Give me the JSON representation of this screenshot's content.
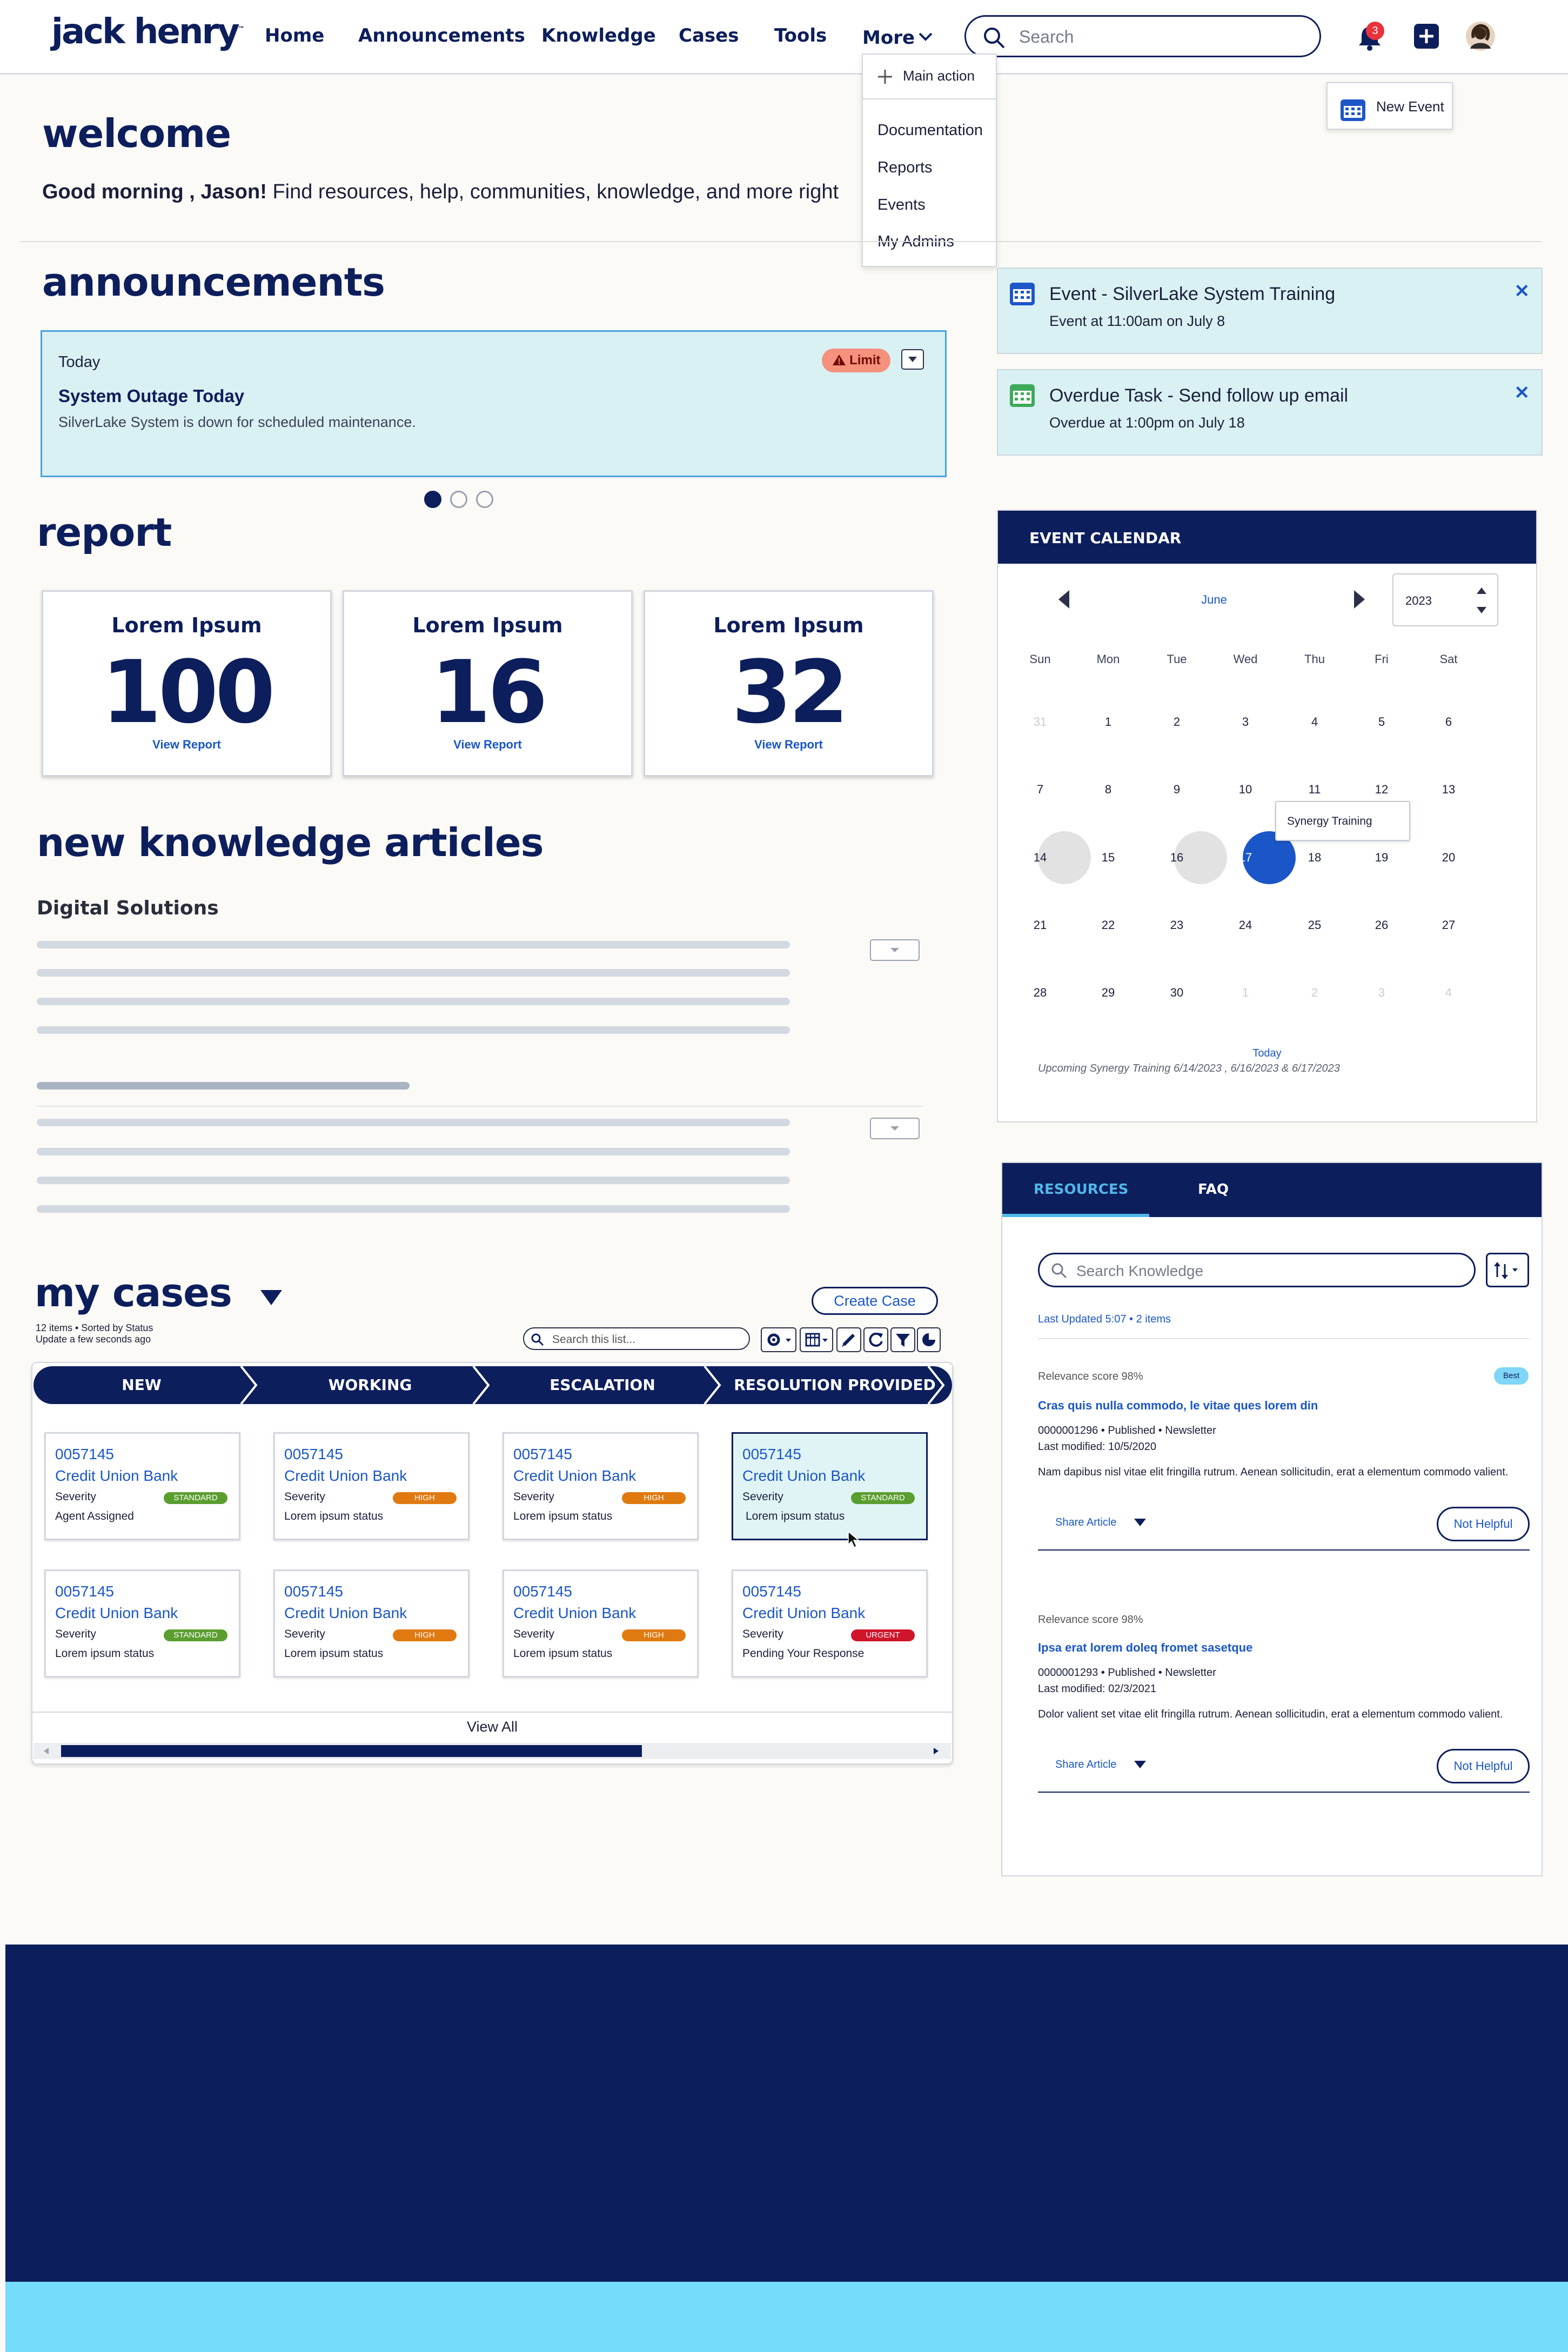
{
  "header": {
    "logo": "jack henry",
    "logo_tm": "™",
    "nav": [
      "Home",
      "Announcements",
      "Knowledge",
      "Cases",
      "Tools",
      "More"
    ],
    "search_placeholder": "Search",
    "notification_count": "3"
  },
  "more_menu": {
    "main_action": "Main action",
    "items": [
      "Documentation",
      "Reports",
      "Events",
      "My Admins"
    ]
  },
  "new_event_label": "New Event",
  "welcome": {
    "title": "welcome",
    "greeting_bold": "Good morning , Jason!",
    "greeting_rest": " Find resources, help, communities, knowledge, and more right"
  },
  "announcements": {
    "title": "announcements",
    "card": {
      "date": "Today",
      "badge": "Limit",
      "headline": "System Outage Today",
      "body": "SilverLake System is down for scheduled maintenance."
    },
    "pager_count": 3
  },
  "notices": [
    {
      "title": "Event - SilverLake System Training",
      "sub": "Event at 11:00am on July 8",
      "color": "#1e55c8"
    },
    {
      "title": "Overdue Task - Send follow up email",
      "sub": "Overdue at 1:00pm on July 18",
      "color": "#3da95a"
    }
  ],
  "report": {
    "title": "report",
    "cards": [
      {
        "title": "Lorem Ipsum",
        "value": "100",
        "link": "View Report"
      },
      {
        "title": "Lorem Ipsum",
        "value": "16",
        "link": "View Report"
      },
      {
        "title": "Lorem Ipsum",
        "value": "32",
        "link": "View Report"
      }
    ]
  },
  "knowledge": {
    "title": "new knowledge articles",
    "subtitle": "Digital Solutions"
  },
  "cases": {
    "title": "my cases",
    "meta1": "12 items • Sorted by Status",
    "meta2": "Update a few seconds ago",
    "create_label": "Create Case",
    "search_placeholder": "Search this list...",
    "stages": [
      "NEW",
      "WORKING",
      "ESCALATION",
      "RESOLUTION PROVIDED"
    ],
    "rows": [
      [
        {
          "id": "0057145",
          "org": "Credit Union Bank",
          "sev_label": "Severity",
          "tag": "STANDARD",
          "tag_color": "#5a9e2f",
          "status": "Agent Assigned"
        },
        {
          "id": "0057145",
          "org": "Credit Union Bank",
          "sev_label": "Severity",
          "tag": "HIGH",
          "tag_color": "#e07a10",
          "status": "Lorem ipsum status"
        },
        {
          "id": "0057145",
          "org": "Credit Union Bank",
          "sev_label": "Severity",
          "tag": "HIGH",
          "tag_color": "#e07a10",
          "status": "Lorem ipsum status"
        },
        {
          "id": "0057145",
          "org": "Credit Union Bank",
          "sev_label": "Severity",
          "tag": "STANDARD",
          "tag_color": "#5a9e2f",
          "status": "Lorem ipsum status"
        }
      ],
      [
        {
          "id": "0057145",
          "org": "Credit Union Bank",
          "sev_label": "Severity",
          "tag": "STANDARD",
          "tag_color": "#5a9e2f",
          "status": "Lorem ipsum status"
        },
        {
          "id": "0057145",
          "org": "Credit Union Bank",
          "sev_label": "Severity",
          "tag": "HIGH",
          "tag_color": "#e07a10",
          "status": "Lorem ipsum status"
        },
        {
          "id": "0057145",
          "org": "Credit Union Bank",
          "sev_label": "Severity",
          "tag": "HIGH",
          "tag_color": "#e07a10",
          "status": "Lorem ipsum status"
        },
        {
          "id": "0057145",
          "org": "Credit Union Bank",
          "sev_label": "Severity",
          "tag": "URGENT",
          "tag_color": "#d0142a",
          "status": "Pending Your Response"
        }
      ]
    ],
    "view_all": "View All"
  },
  "calendar": {
    "title": "EVENT CALENDAR",
    "month": "June",
    "year": "2023",
    "dow": [
      "Sun",
      "Mon",
      "Tue",
      "Wed",
      "Thu",
      "Fri",
      "Sat"
    ],
    "weeks": [
      [
        "31",
        "1",
        "2",
        "3",
        "4",
        "5",
        "6"
      ],
      [
        "7",
        "8",
        "9",
        "10",
        "11",
        "12",
        "13"
      ],
      [
        "14",
        "15",
        "16",
        "17",
        "18",
        "19",
        "20"
      ],
      [
        "21",
        "22",
        "23",
        "24",
        "25",
        "26",
        "27"
      ],
      [
        "28",
        "29",
        "30",
        "1",
        "2",
        "3",
        "4"
      ]
    ],
    "tooltip": "Synergy Training",
    "today_label": "Today",
    "upcoming": "Upcoming Synergy Training 6/14/2023 , 6/16/2023 & 6/17/2023"
  },
  "resources": {
    "tabs": [
      "RESOURCES",
      "FAQ"
    ],
    "search_placeholder": "Search Knowledge",
    "last_updated": "Last Updated 5:07 • 2 items",
    "articles": [
      {
        "score": "Relevance score 98%",
        "badge": "Best",
        "title": "Cras quis nulla commodo, le vitae ques lorem din",
        "meta": "0000001296 • Published • Newsletter",
        "modified": "Last modified: 10/5/2020",
        "body": "Nam dapibus nisl vitae elit fringilla rutrum. Aenean sollicitudin, erat a elementum commodo valient.",
        "share": "Share Article",
        "not_helpful": "Not Helpful"
      },
      {
        "score": "Relevance score 98%",
        "badge": "",
        "title": "Ipsa erat lorem doleq fromet sasetque",
        "meta": "0000001293 • Published • Newsletter",
        "modified": "Last modified: 02/3/2021",
        "body": "Dolor valient set vitae elit fringilla rutrum. Aenean sollicitudin, erat a elementum commodo valient.",
        "share": "Share Article",
        "not_helpful": "Not Helpful"
      }
    ]
  },
  "colors": {
    "navy": "#0d1e5c",
    "footer": "#0d1e5c",
    "footer_band": "#75dcfb",
    "accent": "#1a56c7"
  }
}
